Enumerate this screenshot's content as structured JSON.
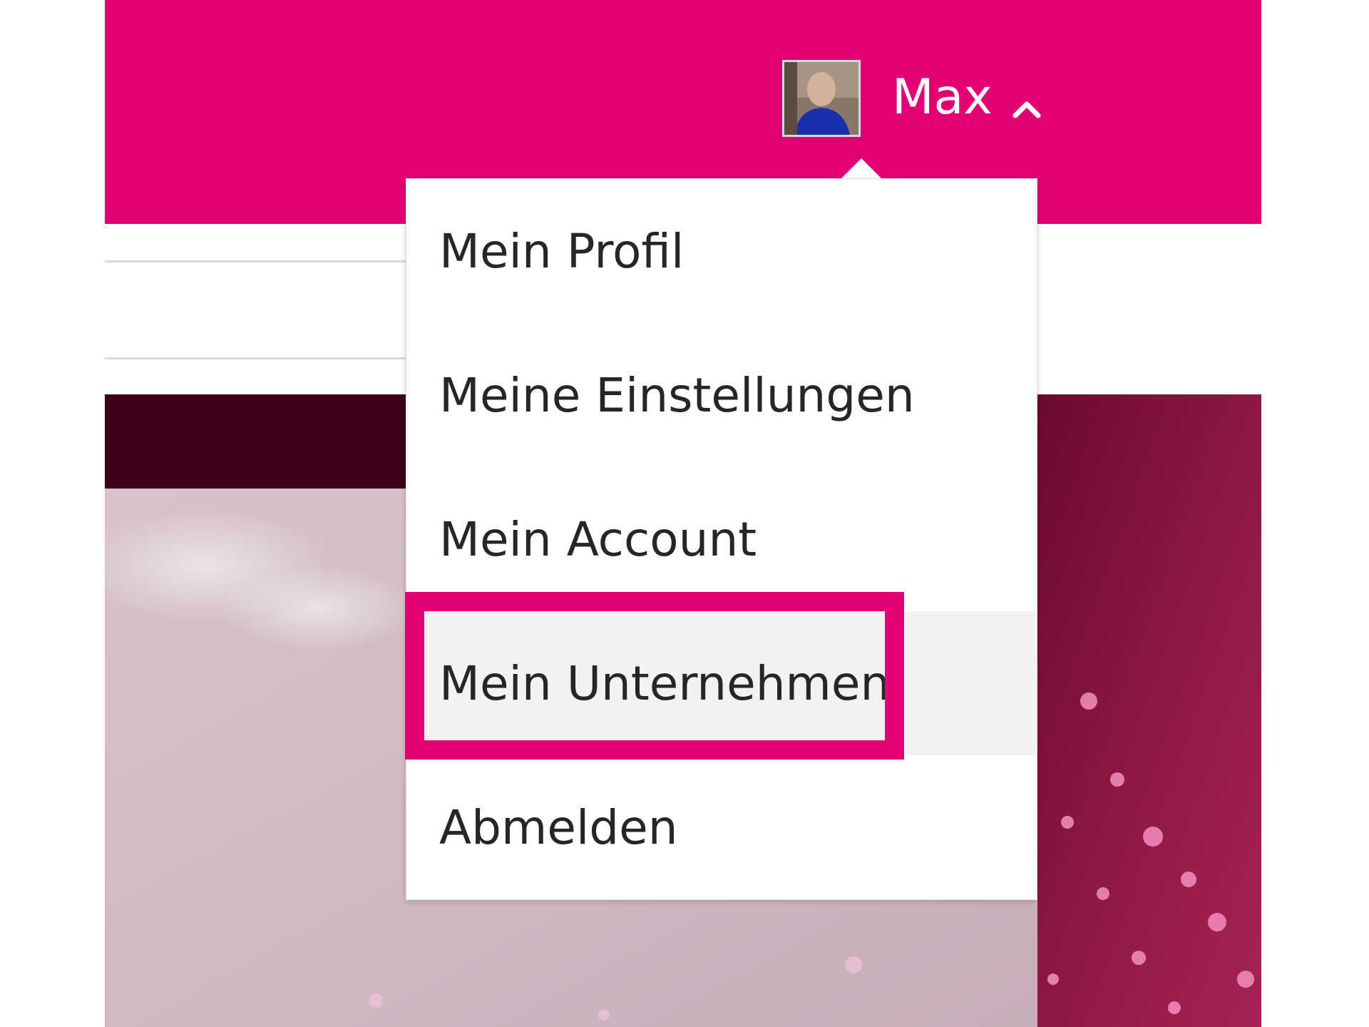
{
  "header": {
    "user_name": "Max",
    "brand_color": "#e20074",
    "avatar_icon": "user-avatar-photo",
    "toggle_icon": "chevron-up-icon"
  },
  "dropdown": {
    "items": [
      {
        "label": "Mein Profil"
      },
      {
        "label": "Meine Einstellungen"
      },
      {
        "label": "Mein Account"
      },
      {
        "label": "Mein Unternehmen",
        "state": "hovered"
      },
      {
        "label": "Abmelden"
      }
    ]
  },
  "annotation": {
    "highlight_color": "#e20074",
    "highlighted_item": "Mein Unternehmen"
  }
}
